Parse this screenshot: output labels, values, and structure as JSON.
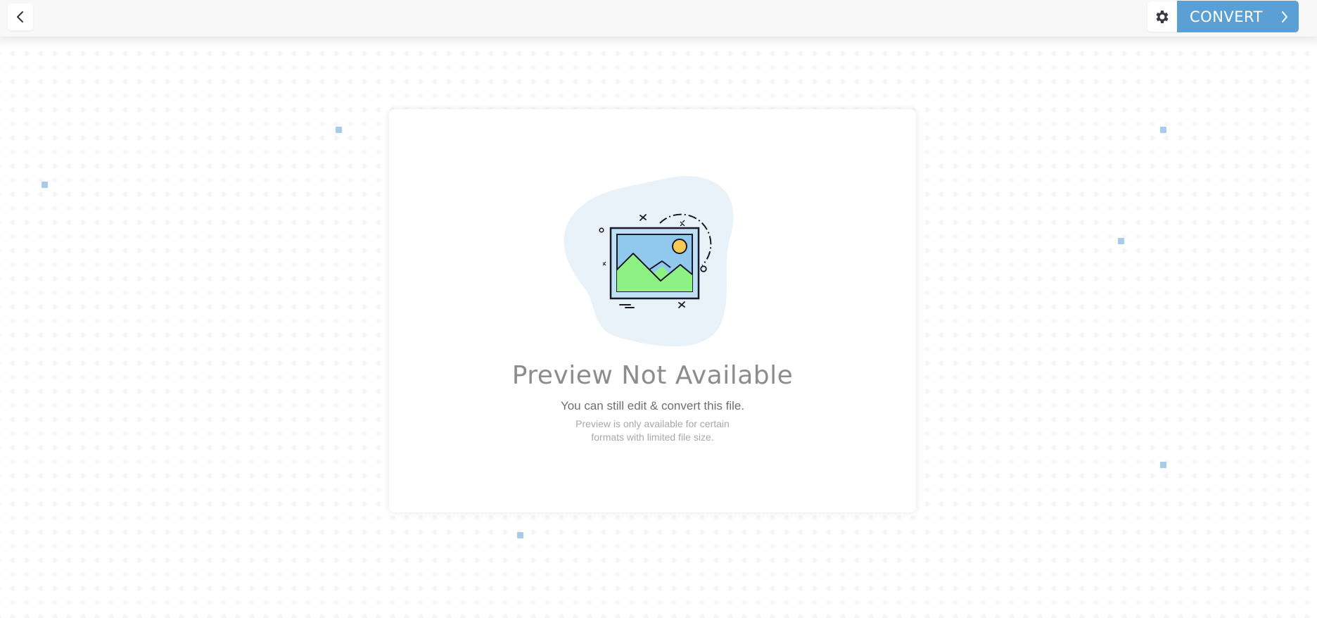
{
  "header": {
    "back_icon": "chevron-left-icon",
    "settings_icon": "gear-icon",
    "convert_label": "CONVERT",
    "convert_icon": "chevron-right-icon"
  },
  "preview": {
    "illustration": "image-placeholder-icon",
    "title": "Preview Not Available",
    "subtitle": "You can still edit & convert this file.",
    "note_line1": "Preview is only available for certain",
    "note_line2": "formats with limited file size."
  },
  "colors": {
    "accent": "#5ba0d4",
    "accent_square": "#a9cbea",
    "title_text": "#8c8c8c",
    "subtitle_text": "#6e6e6e",
    "note_text": "#a8a8a8"
  }
}
